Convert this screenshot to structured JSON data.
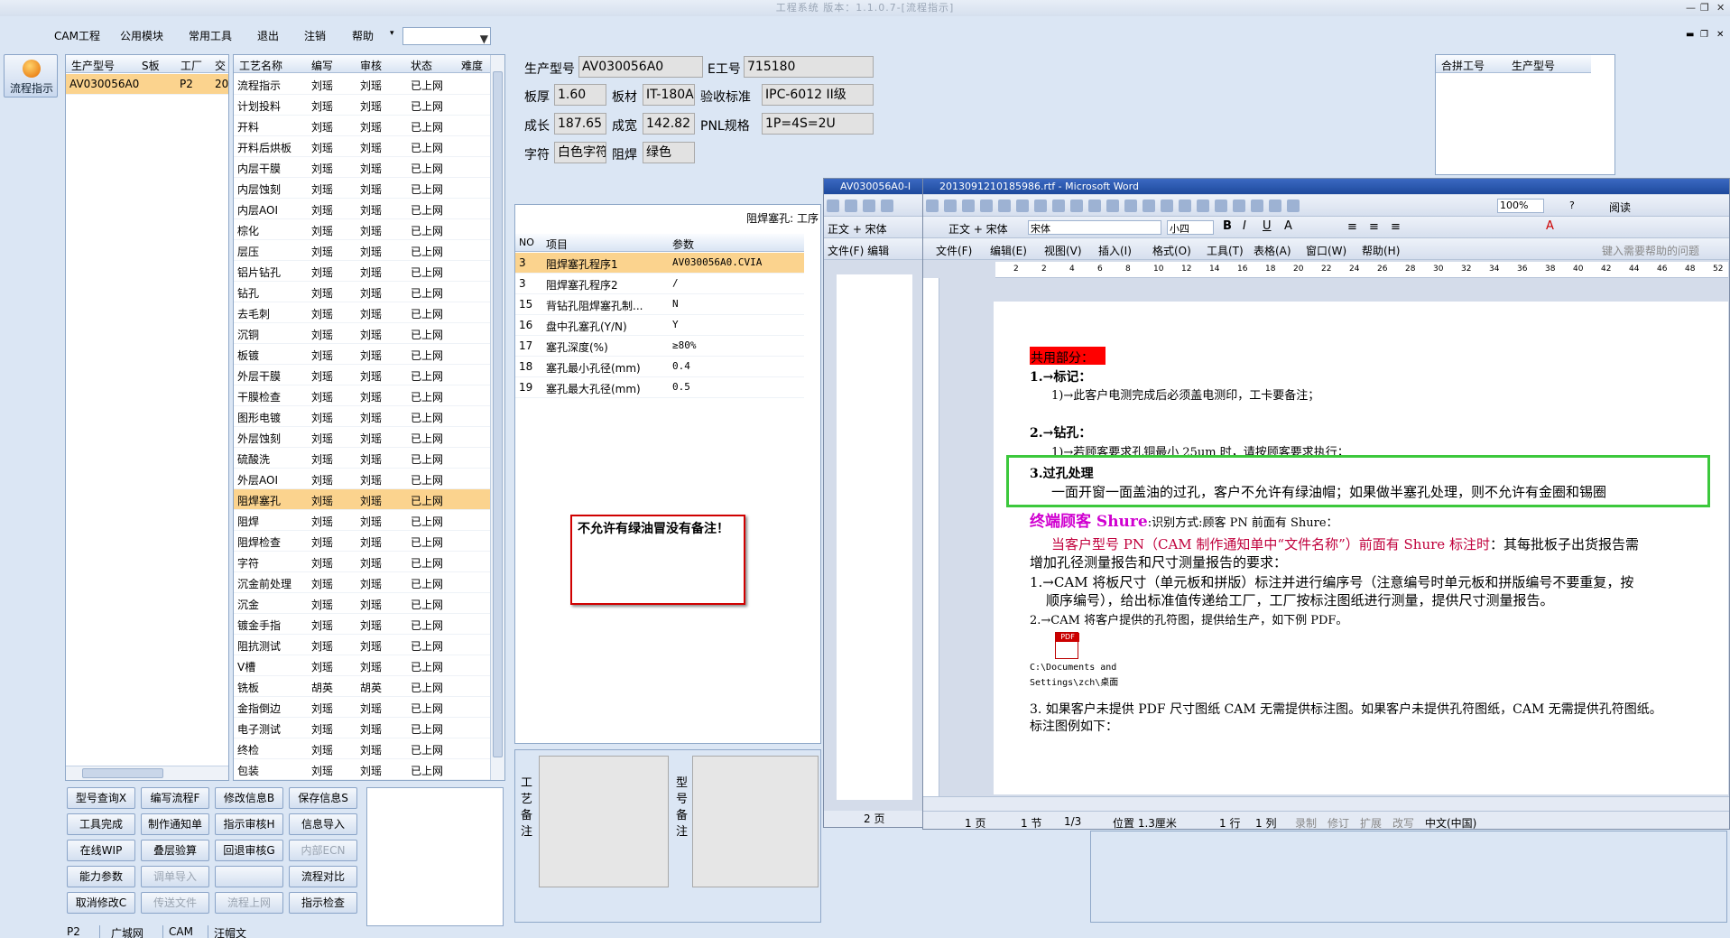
{
  "window": {
    "title": "工程系统 版本：1.1.0.7-[流程指示]"
  },
  "menu": {
    "items": [
      "CAM工程",
      "公用模块",
      "常用工具",
      "退出",
      "注销",
      "帮助"
    ]
  },
  "left_nav": {
    "label": "流程指示"
  },
  "model_grid": {
    "headers": [
      "生产型号",
      "S板",
      "工厂",
      "交"
    ],
    "rows": [
      {
        "model": "AV030056A0",
        "s": "",
        "factory": "P2",
        "delivery": "20"
      }
    ]
  },
  "process_grid": {
    "headers": [
      "工艺名称",
      "编写",
      "审核",
      "状态",
      "难度"
    ],
    "rows": [
      [
        "流程指示",
        "刘瑶",
        "刘瑶",
        "已上网"
      ],
      [
        "计划投料",
        "刘瑶",
        "刘瑶",
        "已上网"
      ],
      [
        "开料",
        "刘瑶",
        "刘瑶",
        "已上网"
      ],
      [
        "开料后烘板",
        "刘瑶",
        "刘瑶",
        "已上网"
      ],
      [
        "内层干膜",
        "刘瑶",
        "刘瑶",
        "已上网"
      ],
      [
        "内层蚀刻",
        "刘瑶",
        "刘瑶",
        "已上网"
      ],
      [
        "内层AOI",
        "刘瑶",
        "刘瑶",
        "已上网"
      ],
      [
        "棕化",
        "刘瑶",
        "刘瑶",
        "已上网"
      ],
      [
        "层压",
        "刘瑶",
        "刘瑶",
        "已上网"
      ],
      [
        "铝片钻孔",
        "刘瑶",
        "刘瑶",
        "已上网"
      ],
      [
        "钻孔",
        "刘瑶",
        "刘瑶",
        "已上网"
      ],
      [
        "去毛刺",
        "刘瑶",
        "刘瑶",
        "已上网"
      ],
      [
        "沉铜",
        "刘瑶",
        "刘瑶",
        "已上网"
      ],
      [
        "板镀",
        "刘瑶",
        "刘瑶",
        "已上网"
      ],
      [
        "外层干膜",
        "刘瑶",
        "刘瑶",
        "已上网"
      ],
      [
        "干膜检查",
        "刘瑶",
        "刘瑶",
        "已上网"
      ],
      [
        "图形电镀",
        "刘瑶",
        "刘瑶",
        "已上网"
      ],
      [
        "外层蚀刻",
        "刘瑶",
        "刘瑶",
        "已上网"
      ],
      [
        "硫酸洗",
        "刘瑶",
        "刘瑶",
        "已上网"
      ],
      [
        "外层AOI",
        "刘瑶",
        "刘瑶",
        "已上网"
      ],
      [
        "阻焊塞孔",
        "刘瑶",
        "刘瑶",
        "已上网"
      ],
      [
        "阻焊",
        "刘瑶",
        "刘瑶",
        "已上网"
      ],
      [
        "阻焊检查",
        "刘瑶",
        "刘瑶",
        "已上网"
      ],
      [
        "字符",
        "刘瑶",
        "刘瑶",
        "已上网"
      ],
      [
        "沉金前处理",
        "刘瑶",
        "刘瑶",
        "已上网"
      ],
      [
        "沉金",
        "刘瑶",
        "刘瑶",
        "已上网"
      ],
      [
        "镀金手指",
        "刘瑶",
        "刘瑶",
        "已上网"
      ],
      [
        "阻抗测试",
        "刘瑶",
        "刘瑶",
        "已上网"
      ],
      [
        "V槽",
        "刘瑶",
        "刘瑶",
        "已上网"
      ],
      [
        "铣板",
        "胡英",
        "胡英",
        "已上网"
      ],
      [
        "金指倒边",
        "刘瑶",
        "刘瑶",
        "已上网"
      ],
      [
        "电子测试",
        "刘瑶",
        "刘瑶",
        "已上网"
      ],
      [
        "终检",
        "刘瑶",
        "刘瑶",
        "已上网"
      ],
      [
        "包装",
        "刘瑶",
        "刘瑶",
        "已上网"
      ]
    ],
    "selected_index": 20
  },
  "buttons": [
    [
      "型号查询X",
      "编写流程F",
      "修改信息B",
      "保存信息S"
    ],
    [
      "工具完成",
      "制作通知单",
      "指示审核H",
      "信息导入"
    ],
    [
      "在线WIP",
      "叠层验算",
      "回退审核G",
      "内部ECN"
    ],
    [
      "能力参数",
      "调单导入",
      "",
      "流程对比"
    ],
    [
      "取消修改C",
      "传送文件",
      "流程上网",
      "指示检查"
    ]
  ],
  "disabled_buttons": [
    "内部ECN",
    "调单导入",
    "传送文件",
    "流程上网"
  ],
  "info": {
    "model_label": "生产型号",
    "model": "AV030056A0",
    "e_label": "E工号",
    "e_no": "715180",
    "thick_label": "板厚",
    "thick": "1.60",
    "mat_label": "板材",
    "mat": "IT-180A",
    "std_label": "验收标准",
    "std": "IPC-6012 II级",
    "len_label": "成长",
    "len": "187.65",
    "wid_label": "成宽",
    "wid": "142.82",
    "pnl_label": "PNL规格",
    "pnl": "1P=4S=2U",
    "char_label": "字符",
    "char": "白色字符",
    "mask_label": "阻焊",
    "mask": "绿色"
  },
  "combine": {
    "headers": [
      "合拼工号",
      "生产型号"
    ]
  },
  "params": {
    "caption": "阻焊塞孔: 工序",
    "headers": [
      "NO",
      "项目",
      "参数"
    ],
    "rows": [
      [
        "3",
        "阻焊塞孔程序1",
        "AV030056A0.CVIA"
      ],
      [
        "3",
        "阻焊塞孔程序2",
        "/"
      ],
      [
        "15",
        "背钻孔阻焊塞孔制...",
        "N"
      ],
      [
        "16",
        "盘中孔塞孔(Y/N)",
        "Y"
      ],
      [
        "17",
        "塞孔深度(%)",
        "≥80%"
      ],
      [
        "18",
        "塞孔最小孔径(mm)",
        "0.4"
      ],
      [
        "19",
        "塞孔最大孔径(mm)",
        "0.5"
      ]
    ]
  },
  "note": {
    "text": "不允许有绿油冒没有备注！"
  },
  "remarks": {
    "process_label": "工艺备注",
    "model_label": "型号备注"
  },
  "word_small": {
    "title": "AV030056A0-I",
    "style": "正文 + 宋体",
    "menu": [
      "文件(F)",
      "编辑"
    ],
    "status": "2 页"
  },
  "word_main": {
    "title": "2013091210185986.rtf - Microsoft Word",
    "menu": [
      "文件(F)",
      "编辑(E)",
      "视图(V)",
      "插入(I)",
      "格式(O)",
      "工具(T)",
      "表格(A)",
      "窗口(W)",
      "帮助(H)"
    ],
    "help_box": "键入需要帮助的问题",
    "style": "正文 + 宋体",
    "font": "宋体",
    "size": "小四",
    "zoom": "100%",
    "read": "阅读",
    "ruler": [
      "2",
      "2",
      "4",
      "6",
      "8",
      "10",
      "12",
      "14",
      "16",
      "18",
      "20",
      "22",
      "24",
      "26",
      "28",
      "30",
      "32",
      "34",
      "36",
      "38",
      "40",
      "42",
      "44",
      "46",
      "48",
      "52"
    ],
    "doc": {
      "h1": "共用部分：",
      "s1": "1.→标记：",
      "s1a": "1)→此客户电测完成后必须盖电测印，工卡要备注；",
      "s2": "2.→钻孔：",
      "s2a": "1)→若顾客要求孔铜最小 25um 时，请按顾客要求执行；",
      "s3": "3.过孔处理",
      "s3a": "一面开窗一面盖油的过孔，客户不允许有绿油帽；如果做半塞孔处理，则不允许有金圈和锡圈",
      "end_title": "终端顾客 Shure",
      "end_rest": ":识别方式:顾客 PN 前面有 Shure：",
      "p1a": "当客户型号 PN（CAM 制作通知单中“文件名称”）前面有 Shure 标注时",
      "p1b": "：其每批板子出货报告需",
      "p2": "增加孔径测量报告和尺寸测量报告的要求：",
      "i1a": "1.→CAM 将板尺寸（单元板和拼版）标注并进行编序号（注意编号时单元板和拼版编号不要重复，按",
      "i1b": "顺序编号），给出标准值传递给工厂，工厂按标注图纸进行测量，提供尺寸测量报告。",
      "i2": "2.→CAM 将客户提供的孔符图，提供给生产，如下例 PDF。",
      "pdf": "PDF",
      "pdf_cap1": "C:\\Documents and",
      "pdf_cap2": "Settings\\zch\\桌面",
      "i3a": "3. 如果客户未提供 PDF 尺寸图纸 CAM 无需提供标注图。如果客户未提供孔符图纸，CAM 无需提供孔符图纸。",
      "i3b": "标注图例如下："
    },
    "status": [
      "1 页",
      "1 节",
      "1/3",
      "位置 1.3厘米",
      "1 行",
      "1 列",
      "录制",
      "修订",
      "扩展",
      "改写",
      "中文(中国)"
    ]
  },
  "bottom_tabs": [
    "P2",
    "广城网",
    "CAM",
    "汪帽文"
  ],
  "accent": {
    "selected": "#fbd38e",
    "note_border": "#d00000",
    "highlight": "#3cc83c"
  }
}
